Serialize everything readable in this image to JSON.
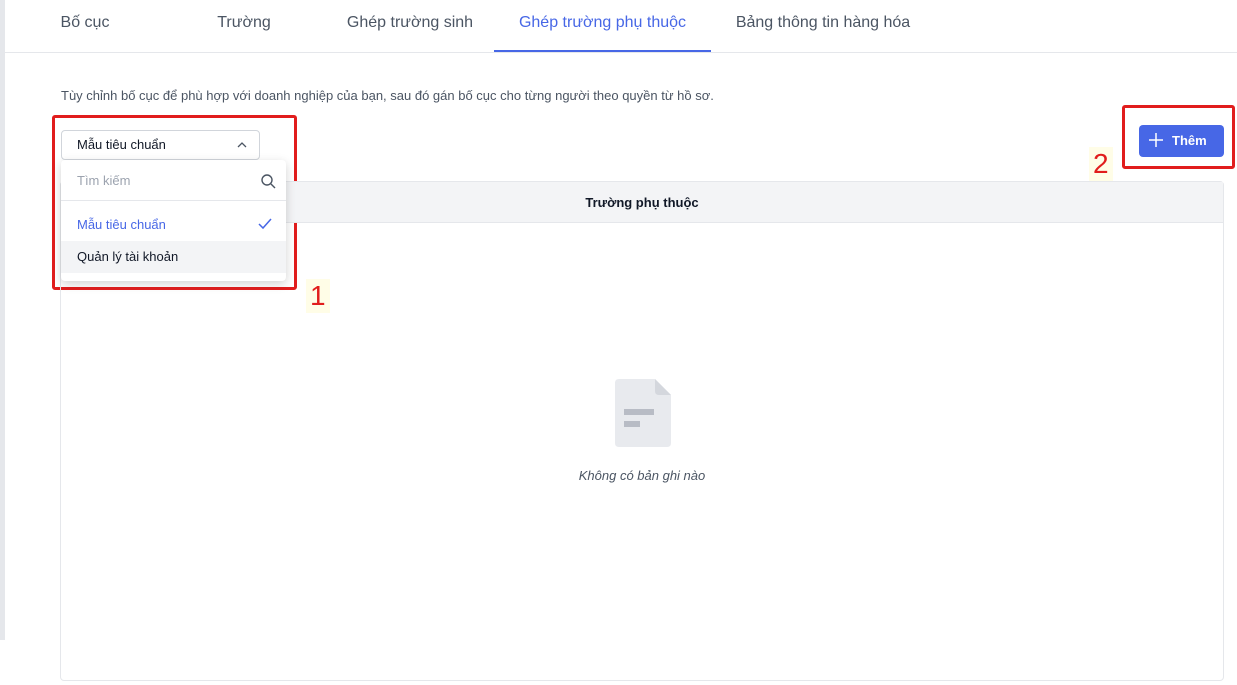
{
  "tabs": [
    {
      "label": "Bố cục"
    },
    {
      "label": "Trường"
    },
    {
      "label": "Ghép trường sinh"
    },
    {
      "label": "Ghép trường phụ thuộc",
      "active": true
    },
    {
      "label": "Bảng thông tin hàng hóa"
    }
  ],
  "description": "Tùy chỉnh bố cục để phù hợp với doanh nghiệp của bạn, sau đó gán bố cục cho từng người theo quyền từ hồ sơ.",
  "layout_select": {
    "value": "Mẫu tiêu chuẩn",
    "search_placeholder": "Tìm kiếm",
    "options": [
      {
        "label": "Mẫu tiêu chuẩn",
        "selected": true
      },
      {
        "label": "Quản lý tài khoản",
        "selected": false
      }
    ]
  },
  "add_button": {
    "label": "Thêm"
  },
  "table": {
    "header": "Trường phụ thuộc",
    "empty_text": "Không có bản ghi nào"
  },
  "annotations": [
    "1",
    "2"
  ],
  "colors": {
    "accent": "#4767e6",
    "annotation": "#e11d1d"
  }
}
